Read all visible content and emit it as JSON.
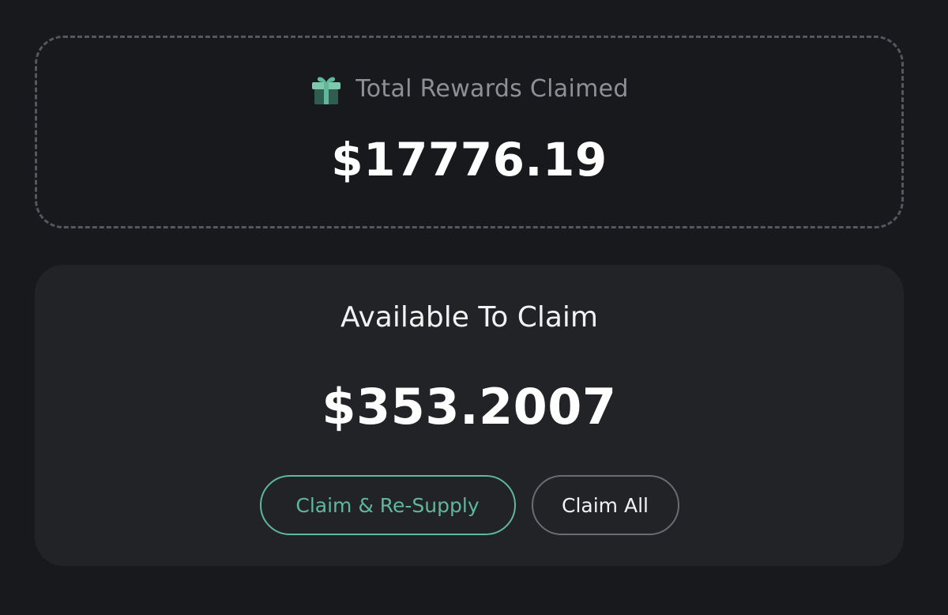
{
  "total_rewards": {
    "icon": "gift-icon",
    "label": "Total Rewards Claimed",
    "value": "$17776.19"
  },
  "available": {
    "label": "Available To Claim",
    "value": "$353.2007",
    "buttons": {
      "resupply_label": "Claim & Re-Supply",
      "claim_all_label": "Claim All"
    }
  },
  "colors": {
    "background": "#18191d",
    "card": "#222327",
    "accent": "#5fb89a",
    "muted_text": "#8e9096"
  }
}
